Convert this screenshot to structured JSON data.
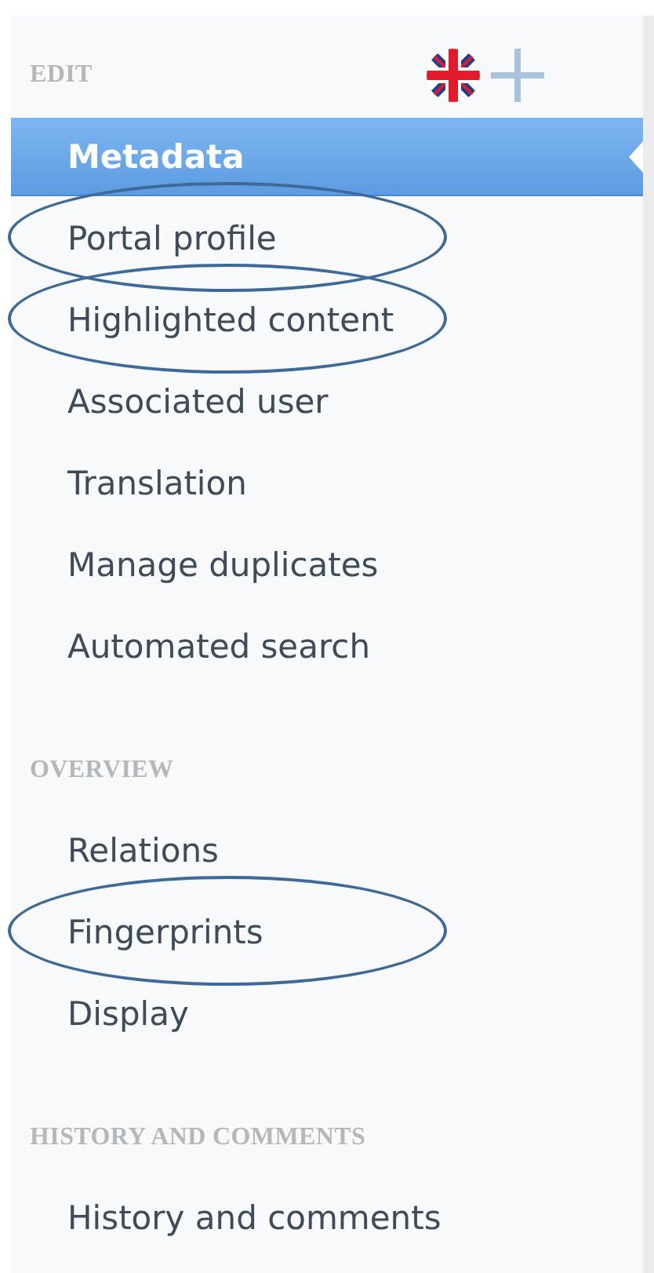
{
  "sections": [
    {
      "title": "EDIT",
      "language_switch": true,
      "items": [
        {
          "label": "Metadata",
          "selected": true,
          "annotated": false
        },
        {
          "label": "Portal profile",
          "selected": false,
          "annotated": true
        },
        {
          "label": "Highlighted content",
          "selected": false,
          "annotated": true
        },
        {
          "label": "Associated user",
          "selected": false,
          "annotated": false
        },
        {
          "label": "Translation",
          "selected": false,
          "annotated": false
        },
        {
          "label": "Manage duplicates",
          "selected": false,
          "annotated": false
        },
        {
          "label": "Automated search",
          "selected": false,
          "annotated": false
        }
      ]
    },
    {
      "title": "OVERVIEW",
      "language_switch": false,
      "items": [
        {
          "label": "Relations",
          "selected": false,
          "annotated": false
        },
        {
          "label": "Fingerprints",
          "selected": false,
          "annotated": true
        },
        {
          "label": "Display",
          "selected": false,
          "annotated": false
        }
      ]
    },
    {
      "title": "HISTORY AND COMMENTS",
      "language_switch": false,
      "items": [
        {
          "label": "History and comments",
          "selected": false,
          "annotated": false
        }
      ]
    }
  ]
}
